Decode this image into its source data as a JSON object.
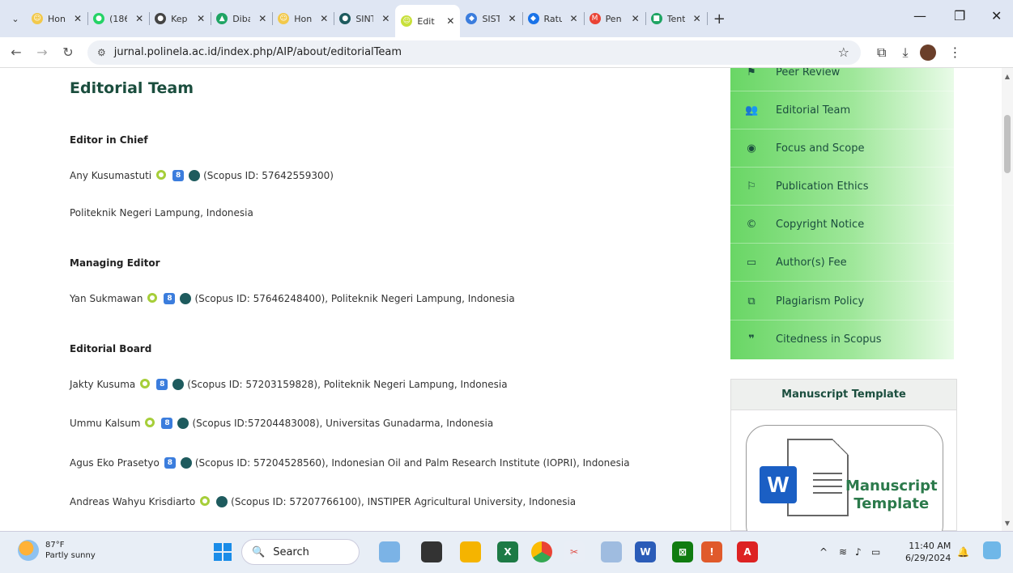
{
  "browser": {
    "tabs": [
      {
        "title": "Hon",
        "color": "#f2c94c",
        "glyph": "☺"
      },
      {
        "title": "(186",
        "color": "#25d366",
        "glyph": "●"
      },
      {
        "title": "Kep",
        "color": "#444444",
        "glyph": "●"
      },
      {
        "title": "Diba",
        "color": "#1fa463",
        "glyph": "▲"
      },
      {
        "title": "Hon",
        "color": "#f2c94c",
        "glyph": "☺"
      },
      {
        "title": "SINT",
        "color": "#1e5b5e",
        "glyph": "●"
      },
      {
        "title": "Edit",
        "color": "#c8e03a",
        "glyph": "☺",
        "active": true
      },
      {
        "title": "SIST",
        "color": "#3b7ddd",
        "glyph": "◆"
      },
      {
        "title": "Ratu",
        "color": "#1a73e8",
        "glyph": "◆"
      },
      {
        "title": "Pen",
        "color": "#ea4335",
        "glyph": "M"
      },
      {
        "title": "Tent",
        "color": "#1fa463",
        "glyph": "■"
      }
    ],
    "new_tab": "+",
    "url": "jurnal.polinela.ac.id/index.php/AIP/about/editorialTeam"
  },
  "page": {
    "title": "Editorial Team",
    "sections": {
      "editor_in_chief": "Editor in Chief",
      "managing_editor": "Managing Editor",
      "editorial_board": "Editorial Board"
    },
    "people": {
      "any": "Any Kusumastuti",
      "any_scopus": "(Scopus ID: 57642559300)",
      "any_affil": "Politeknik Negeri Lampung, Indonesia",
      "yan": "Yan Sukmawan",
      "yan_scopus": "(Scopus ID: 57646248400), Politeknik Negeri Lampung, Indonesia",
      "jakty": "Jakty Kusuma",
      "jakty_scopus": "(Scopus ID: 57203159828), Politeknik Negeri Lampung, Indonesia",
      "ummu": "Ummu Kalsum",
      "ummu_scopus": "(Scopus ID:57204483008), Universitas Gunadarma, Indonesia",
      "agus": "Agus Eko Prasetyo",
      "agus_scopus": "(Scopus ID: 57204528560), Indonesian Oil and Palm Research Institute (IOPRI), Indonesia",
      "andreas": "Andreas Wahyu Krisdiarto",
      "andreas_scopus": "(Scopus ID: 57207766100), INSTIPER Agricultural University, Indonesia"
    }
  },
  "sidebar": {
    "items": [
      {
        "label": "Peer Review",
        "icon": "⚑"
      },
      {
        "label": "Editorial Team",
        "icon": "👥"
      },
      {
        "label": "Focus and Scope",
        "icon": "◉"
      },
      {
        "label": "Publication Ethics",
        "icon": "⚐"
      },
      {
        "label": "Copyright Notice",
        "icon": "©"
      },
      {
        "label": "Author(s) Fee",
        "icon": "▭"
      },
      {
        "label": "Plagiarism Policy",
        "icon": "⧉"
      },
      {
        "label": "Citedness in Scopus",
        "icon": "❞"
      }
    ],
    "manuscript_heading": "Manuscript Template",
    "manuscript_line1": "Manuscript",
    "manuscript_line2": "Template",
    "word_letter": "W"
  },
  "taskbar": {
    "temp": "87°F",
    "weather": "Partly sunny",
    "search": "Search",
    "time": "11:40 AM",
    "date": "6/29/2024"
  }
}
